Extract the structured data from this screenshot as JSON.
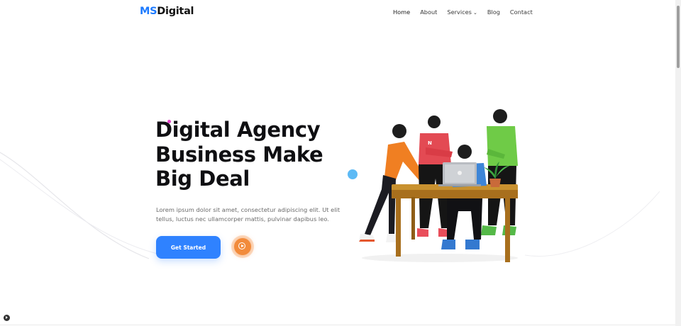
{
  "logo": {
    "part1": "MS",
    "part2": "Digital"
  },
  "nav": {
    "items": [
      {
        "label": "Home"
      },
      {
        "label": "About"
      },
      {
        "label": "Services"
      },
      {
        "label": "Blog"
      },
      {
        "label": "Contact"
      }
    ],
    "active": "Home"
  },
  "hero": {
    "title_line1": "Digital Agency",
    "title_line2": "Business Make",
    "title_line3": "Big Deal",
    "description": "Lorem ipsum dolor sit amet, consectetur adipiscing elit. Ut elit tellus, luctus nec ullamcorper mattis, pulvinar dapibus leo.",
    "cta_label": "Get Started",
    "shirt_letter": "N"
  },
  "colors": {
    "accent": "#2f82ff",
    "logo_blue": "#1e7bff",
    "play_orange": "#f28b3b",
    "dot_pink": "#e443c9",
    "dot_blue": "#5dbaf5"
  },
  "icons": {
    "play": "play-circle-icon",
    "dropdown": "chevron-down-icon",
    "corner": "play-badge-icon"
  }
}
